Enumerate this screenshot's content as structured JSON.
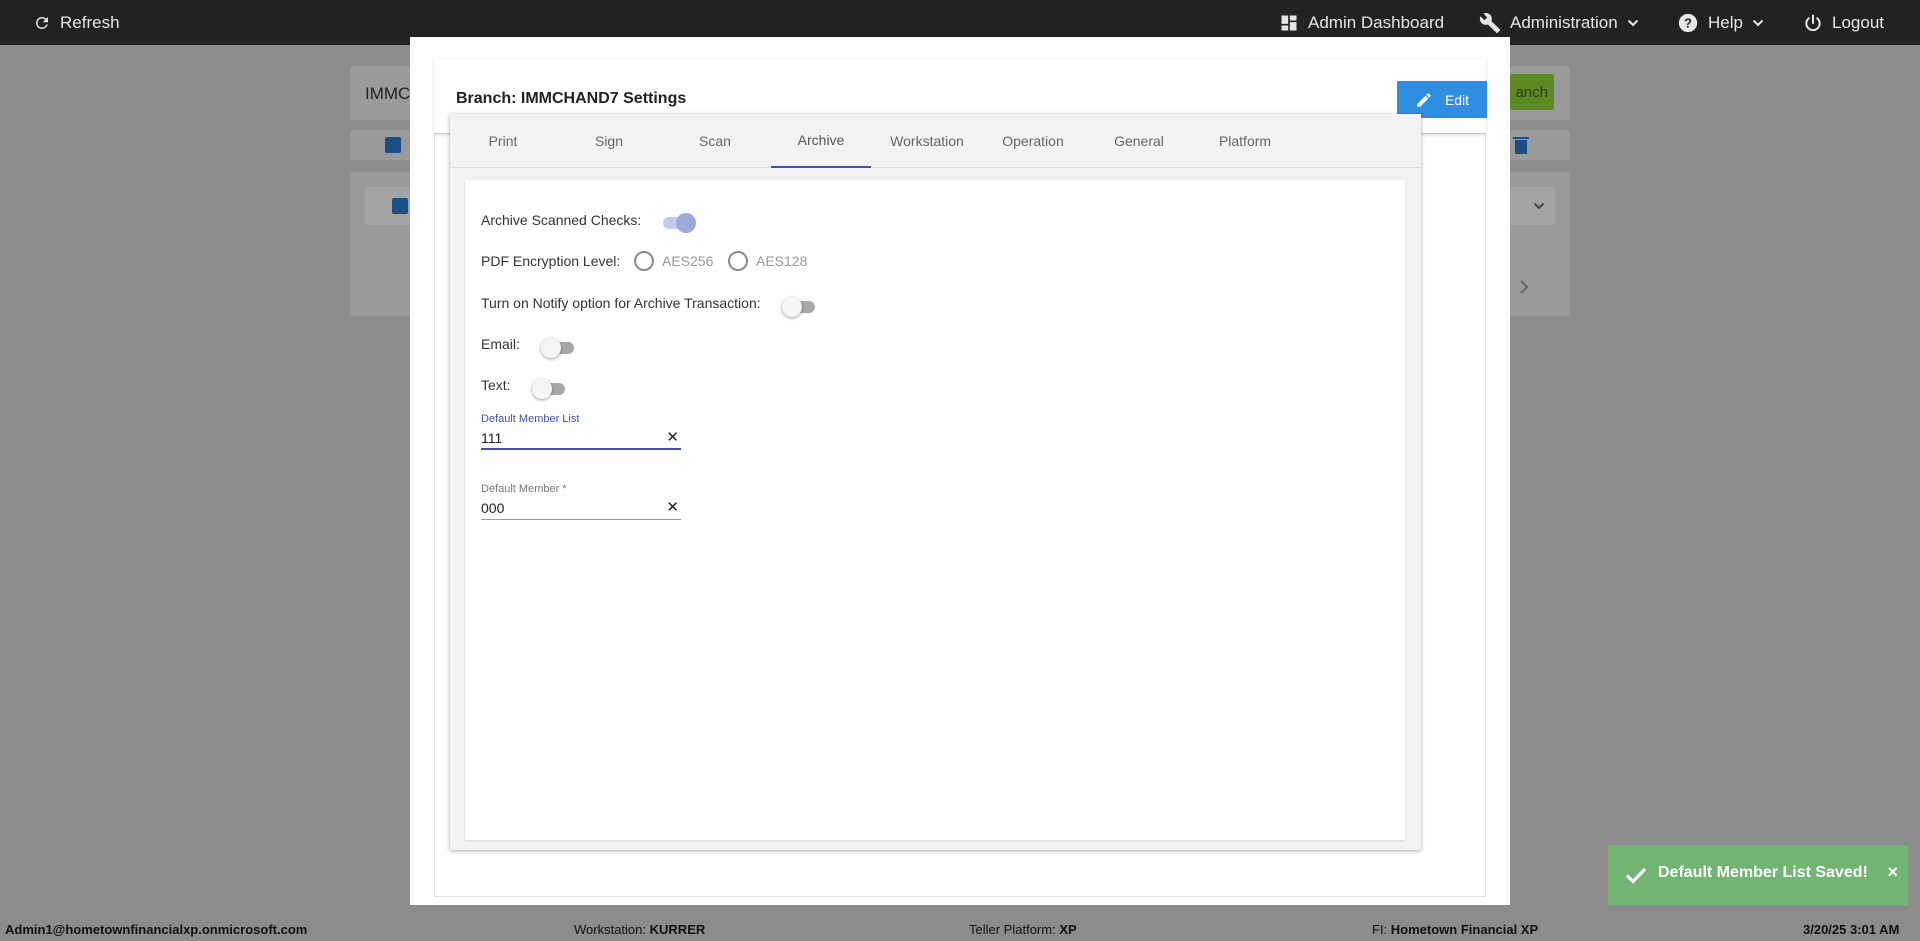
{
  "topbar": {
    "refresh_label": "Refresh",
    "admin_dashboard_label": "Admin Dashboard",
    "administration_label": "Administration",
    "help_label": "Help",
    "logout_label": "Logout"
  },
  "background": {
    "branch_search_value": "IMMC",
    "add_branch_label": "anch"
  },
  "modal": {
    "title": "Branch: IMMCHAND7 Settings",
    "edit_label": "Edit",
    "tabs": [
      {
        "label": "Print"
      },
      {
        "label": "Sign"
      },
      {
        "label": "Scan"
      },
      {
        "label": "Archive"
      },
      {
        "label": "Workstation"
      },
      {
        "label": "Operation"
      },
      {
        "label": "General"
      },
      {
        "label": "Platform"
      }
    ],
    "active_tab": "Archive",
    "archive": {
      "archive_scanned_checks_label": "Archive Scanned Checks:",
      "archive_scanned_checks_on": true,
      "pdf_encryption_label": "PDF Encryption Level:",
      "pdf_options": [
        "AES256",
        "AES128"
      ],
      "notify_label": "Turn on Notify option for Archive Transaction:",
      "notify_on": false,
      "email_label": "Email:",
      "email_on": false,
      "text_label": "Text:",
      "text_on": false,
      "default_member_list_label": "Default Member List",
      "default_member_list_value": "111",
      "default_member_label": "Default Member *",
      "default_member_value": "000"
    }
  },
  "toast": {
    "message": "Default Member List Saved!",
    "close_symbol": "×"
  },
  "statusbar": {
    "user": "Admin1@hometownfinancialxp.onmicrosoft.com",
    "workstation_label": "Workstation:",
    "workstation_value": "KURRER",
    "teller_platform_label": "Teller Platform:",
    "teller_platform_value": "XP",
    "fi_label": "FI:",
    "fi_value": "Hometown Financial XP",
    "datetime": "3/20/25 3:01 AM"
  },
  "colors": {
    "topbar": "#222222",
    "overlay": "#8c8c8c",
    "edit_button": "#2f8ee2",
    "active_tab_indicator": "#3f51b5",
    "toast": "#72b572"
  },
  "icons": {
    "refresh": "refresh-icon",
    "dashboard": "dashboard-icon",
    "wrench": "wrench-icon",
    "help": "help-icon",
    "power": "power-icon",
    "pencil": "pencil-icon",
    "check": "check-icon"
  }
}
